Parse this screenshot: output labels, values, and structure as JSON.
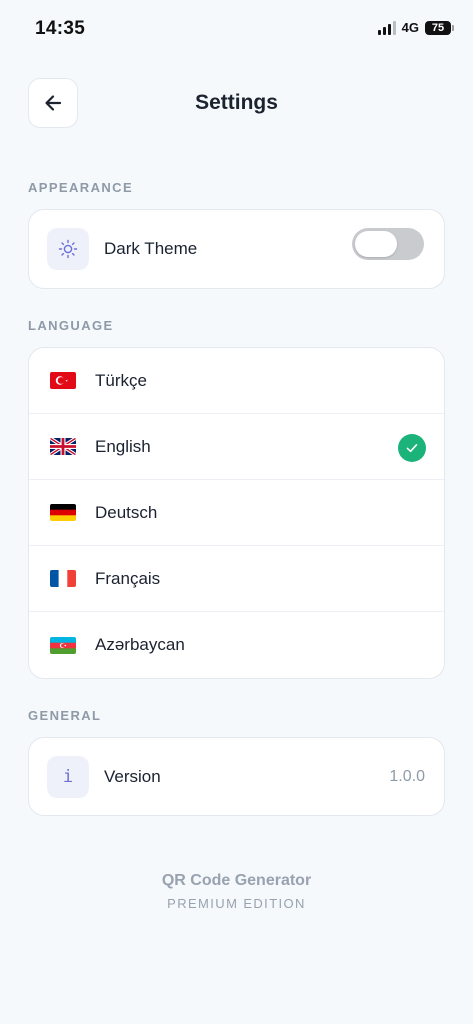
{
  "status_bar": {
    "time": "14:35",
    "network": "4G",
    "battery": "75"
  },
  "header": {
    "title": "Settings",
    "back_icon": "arrow-left-icon"
  },
  "appearance": {
    "section_label": "APPEARANCE",
    "dark_theme": {
      "label": "Dark Theme",
      "icon": "sun-icon",
      "enabled": false
    }
  },
  "language": {
    "section_label": "LANGUAGE",
    "items": [
      {
        "label": "Türkçe",
        "flag": "turkey-flag-icon",
        "selected": false
      },
      {
        "label": "English",
        "flag": "uk-flag-icon",
        "selected": true
      },
      {
        "label": "Deutsch",
        "flag": "germany-flag-icon",
        "selected": false
      },
      {
        "label": "Français",
        "flag": "france-flag-icon",
        "selected": false
      },
      {
        "label": "Azərbaycan",
        "flag": "azerbaijan-flag-icon",
        "selected": false
      }
    ]
  },
  "general": {
    "section_label": "GENERAL",
    "version": {
      "label": "Version",
      "value": "1.0.0",
      "icon": "info-icon"
    }
  },
  "footer": {
    "title": "QR Code Generator",
    "subtitle": "PREMIUM EDITION"
  },
  "colors": {
    "accent": "#1bb37a",
    "icon_tint": "#6b6fd6",
    "toggle_off": "#c9cbcf"
  }
}
